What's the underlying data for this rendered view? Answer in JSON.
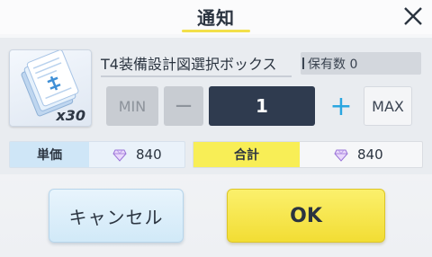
{
  "dialog": {
    "title": "通知",
    "close_icon": "close-x-icon"
  },
  "item": {
    "name": "T4装備設計図選択ボックス",
    "quantity_badge": "x30",
    "icon": "blueprint-icon",
    "owned_label": "保有数 0"
  },
  "quantity": {
    "min_label": "MIN",
    "minus_label": "−",
    "value": "1",
    "plus_label": "+",
    "max_label": "MAX"
  },
  "price": {
    "unit_label": "単価",
    "unit_value": "840",
    "total_label": "合計",
    "total_value": "840",
    "currency_icon": "gem-icon"
  },
  "actions": {
    "cancel_label": "キャンセル",
    "ok_label": "OK"
  },
  "colors": {
    "accent_yellow": "#f3e04a",
    "accent_blue": "#2aa6e0",
    "qty_field": "#2f3b4f"
  }
}
